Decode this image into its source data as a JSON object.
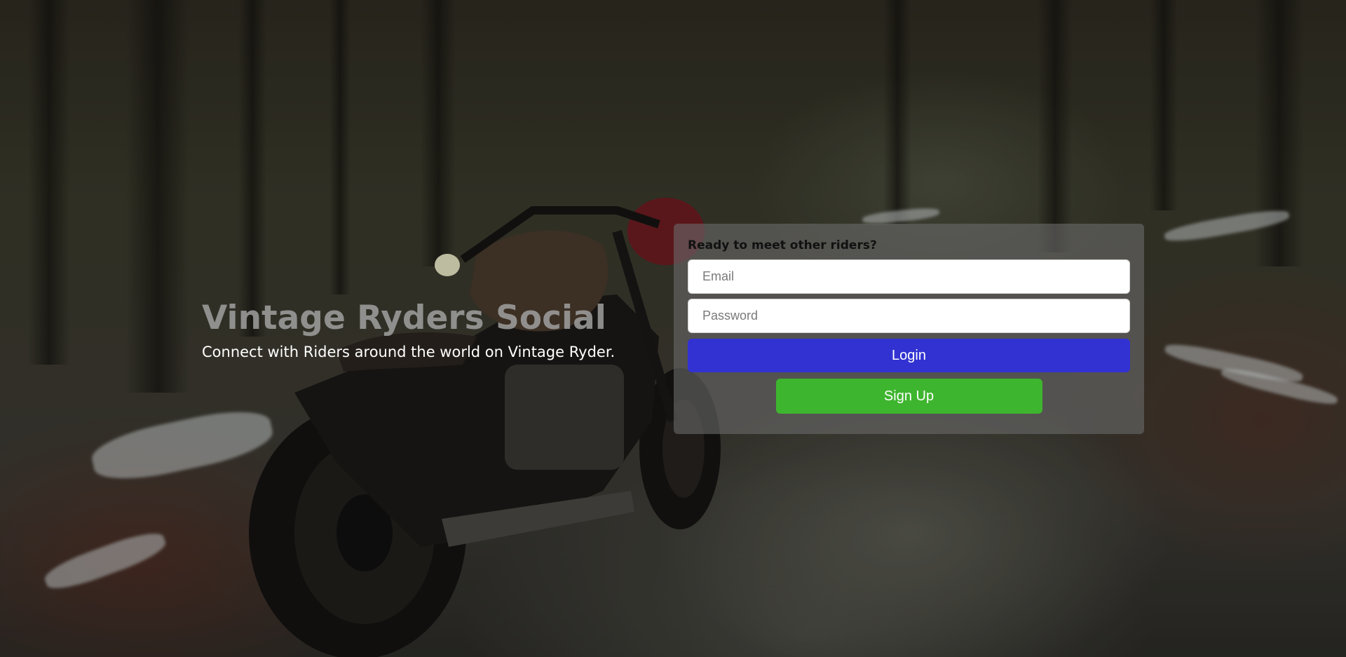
{
  "hero": {
    "title": "Vintage Ryders Social",
    "subtitle": "Connect with Riders around the world on Vintage Ryder."
  },
  "login": {
    "heading": "Ready to meet other riders?",
    "email_placeholder": "Email",
    "password_placeholder": "Password",
    "login_label": "Login",
    "signup_label": "Sign Up"
  },
  "colors": {
    "login_button": "#3232d2",
    "signup_button": "#3eb52e",
    "panel_background": "rgba(105,105,105,0.62)"
  }
}
